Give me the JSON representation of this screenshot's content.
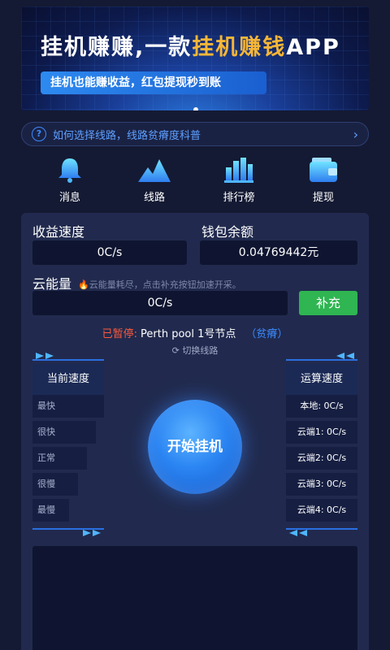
{
  "banner": {
    "title_part1": "挂机赚赚,一款",
    "title_highlight": "挂机赚钱",
    "title_part2": "APP",
    "subtitle": "挂机也能赚收益，红包提现秒到账",
    "title_highlight_color": "#f6b637"
  },
  "help": {
    "text": "如何选择线路，线路贫瘠度科普",
    "icon": "question-circle-icon",
    "chevron": "›"
  },
  "menu": {
    "items": [
      {
        "label": "消息",
        "icon": "bell-icon"
      },
      {
        "label": "线路",
        "icon": "mountain-icon"
      },
      {
        "label": "排行榜",
        "icon": "bar-chart-icon"
      },
      {
        "label": "提现",
        "icon": "wallet-icon"
      }
    ]
  },
  "stats": {
    "income_speed_label": "收益速度",
    "income_speed_value": "0C/s",
    "wallet_label": "钱包余额",
    "wallet_value": "0.04769442元"
  },
  "cloud": {
    "label": "云能量",
    "hint": "云能量耗尽，点击补充按钮加速开采。",
    "value": "0C/s",
    "recharge_button": "补充"
  },
  "status": {
    "paused": "已暂停:",
    "node": "Perth pool 1号节点",
    "quality": "（贫瘠）",
    "switch_line": "切换线路",
    "paused_color": "#ff5a3c"
  },
  "current_speed": {
    "title": "当前速度",
    "levels": [
      "最快",
      "很快",
      "正常",
      "很慢",
      "最慢"
    ]
  },
  "compute_speed": {
    "title": "运算速度",
    "items": [
      "本地: 0C/s",
      "云端1: 0C/s",
      "云端2: 0C/s",
      "云端3: 0C/s",
      "云端4: 0C/s"
    ]
  },
  "start_button": "开始挂机"
}
